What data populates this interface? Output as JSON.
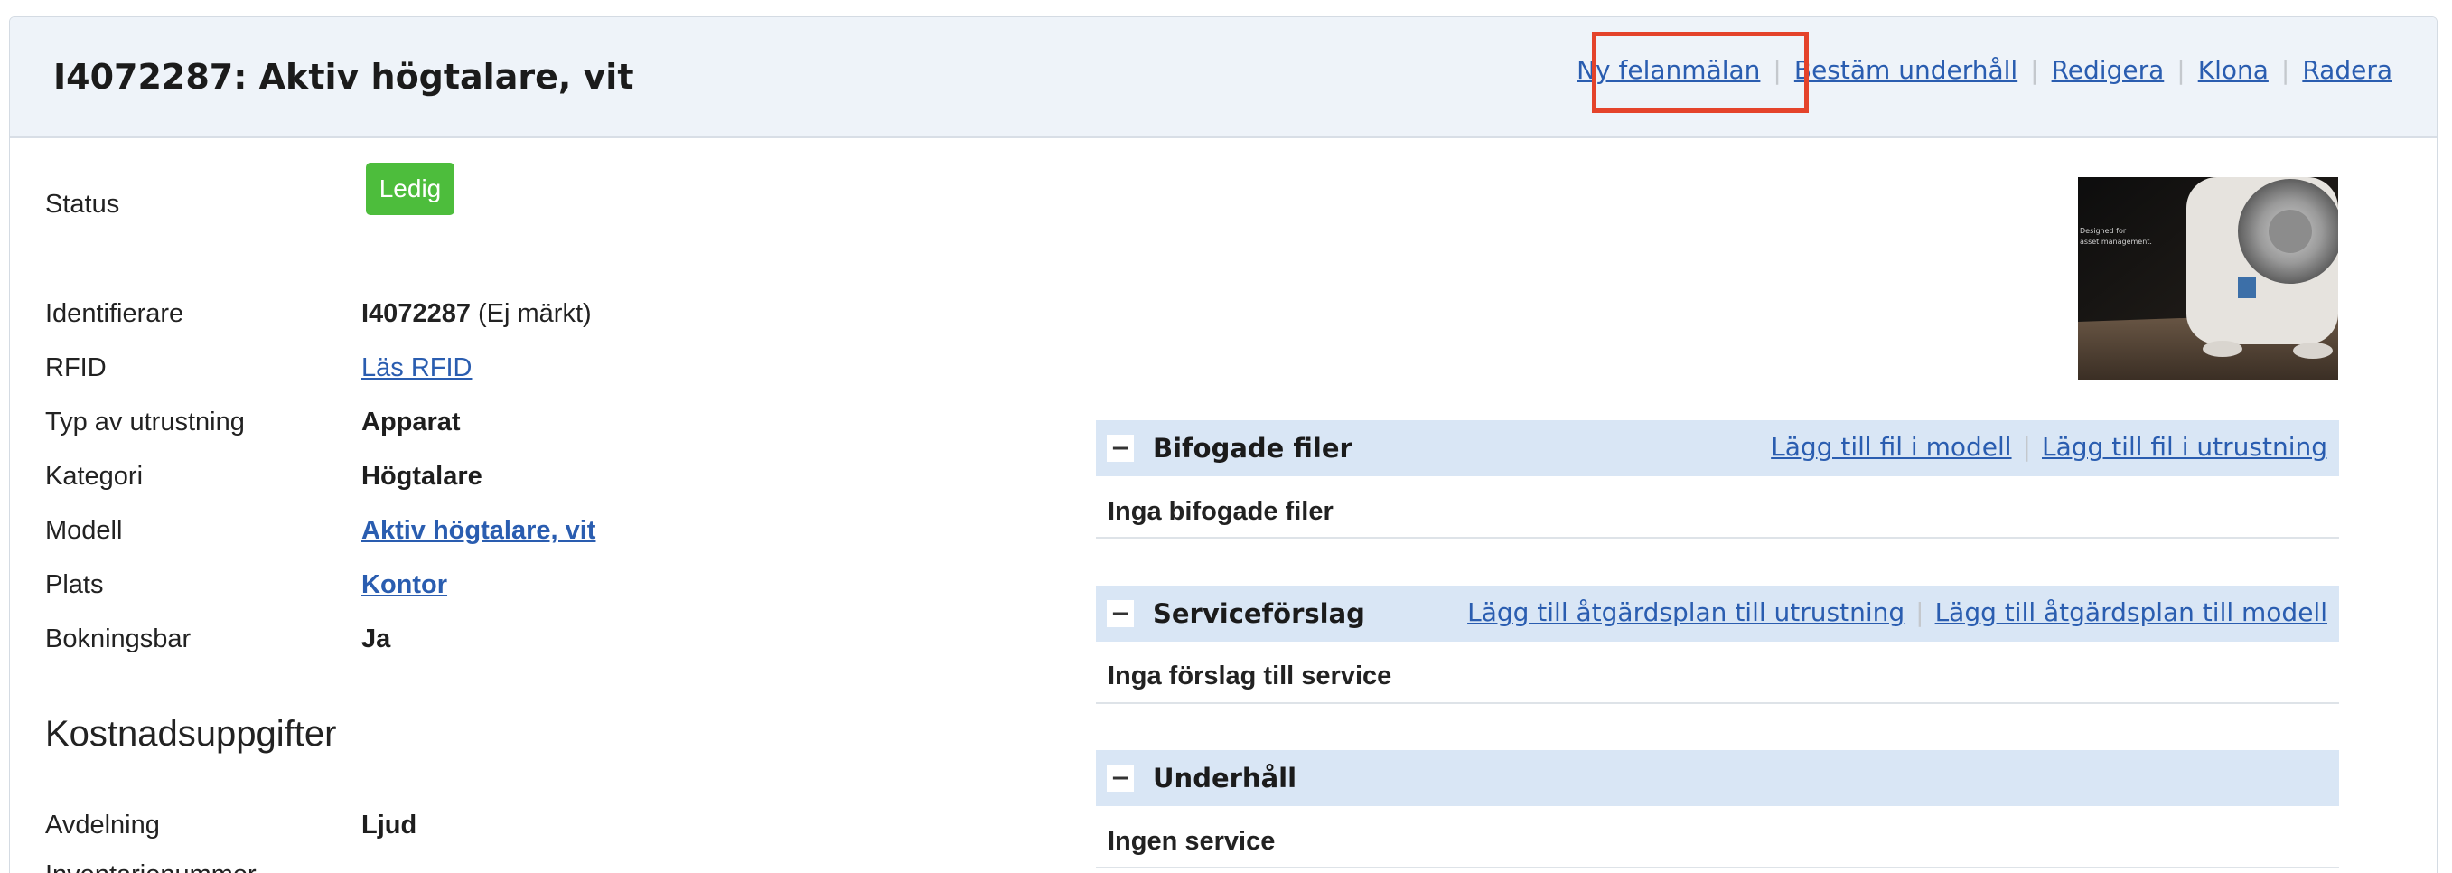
{
  "header": {
    "title": "I4072287: Aktiv högtalare, vit",
    "actions": [
      "Ny felanmälan",
      "Bestäm underhåll",
      "Redigera",
      "Klona",
      "Radera"
    ]
  },
  "details": {
    "status_label": "Status",
    "status_value": "Ledig",
    "status_color": "#4dbd3c",
    "identifier_label": "Identifierare",
    "identifier_value": "I4072287",
    "identifier_note": " (Ej märkt)",
    "rfid_label": "RFID",
    "rfid_value": "Läs RFID",
    "type_label": "Typ av utrustning",
    "type_value": "Apparat",
    "category_label": "Kategori",
    "category_value": "Högtalare",
    "model_label": "Modell",
    "model_value": "Aktiv högtalare, vit",
    "location_label": "Plats",
    "location_value": "Kontor",
    "bookable_label": "Bokningsbar",
    "bookable_value": "Ja"
  },
  "costs": {
    "heading": "Kostnadsuppgifter",
    "department_label": "Avdelning",
    "department_value": "Ljud",
    "next_label": "Inventarienummer"
  },
  "panels": {
    "files": {
      "title": "Bifogade filer",
      "links": [
        "Lägg till fil i modell",
        "Lägg till fil i utrustning"
      ],
      "empty": "Inga bifogade filer"
    },
    "service": {
      "title": "Serviceförslag",
      "links": [
        "Lägg till åtgärdsplan till utrustning",
        "Lägg till åtgärdsplan till modell"
      ],
      "empty": "Inga förslag till service"
    },
    "maintenance": {
      "title": "Underhåll",
      "empty": "Ingen service"
    },
    "collapse_symbol": "−"
  },
  "image": {
    "thumb_text": "Designed for\nasset management."
  }
}
